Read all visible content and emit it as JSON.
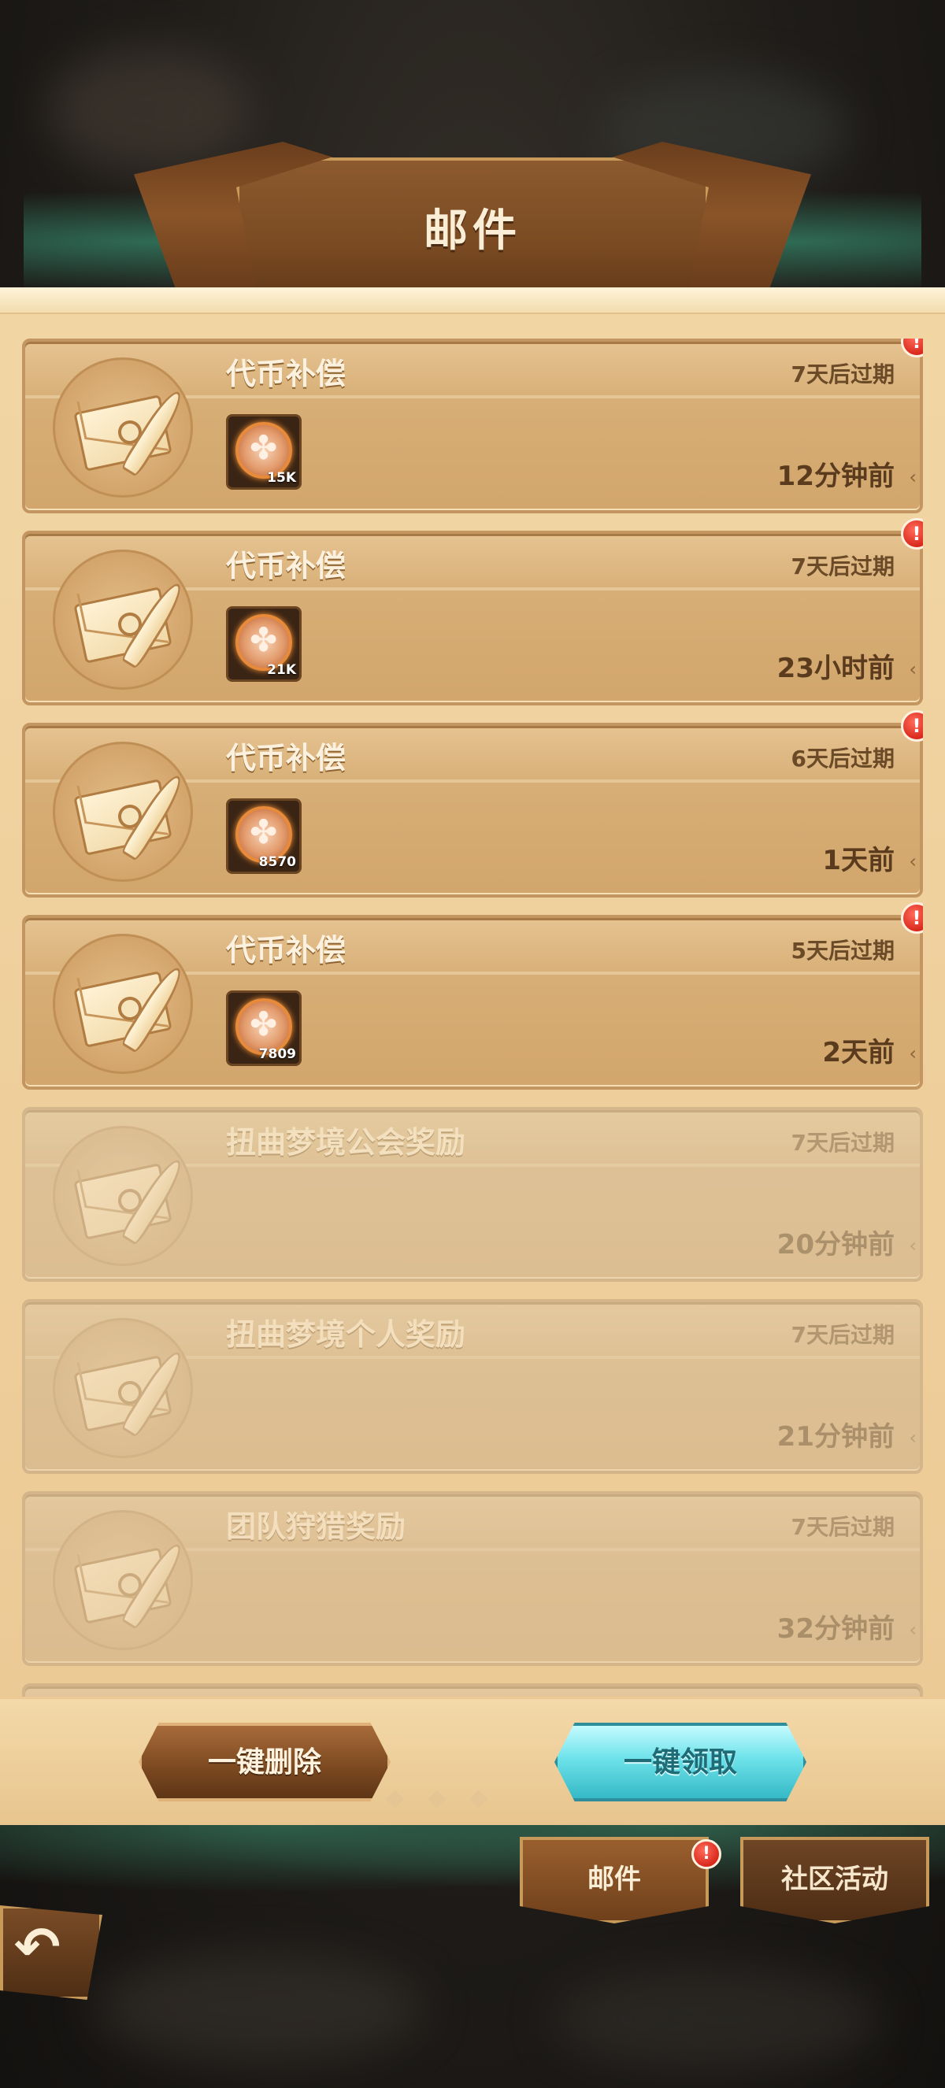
{
  "header": {
    "title": "邮件"
  },
  "mails": [
    {
      "title": "代币补偿",
      "expire": "7天后过期",
      "time": "12分钟前",
      "qty": "15K",
      "unread": true,
      "badge": "!"
    },
    {
      "title": "代币补偿",
      "expire": "7天后过期",
      "time": "23小时前",
      "qty": "21K",
      "unread": true,
      "badge": "!"
    },
    {
      "title": "代币补偿",
      "expire": "6天后过期",
      "time": "1天前",
      "qty": "8570",
      "unread": true,
      "badge": "!"
    },
    {
      "title": "代币补偿",
      "expire": "5天后过期",
      "time": "2天前",
      "qty": "7809",
      "unread": true,
      "badge": "!"
    },
    {
      "title": "扭曲梦境公会奖励",
      "expire": "7天后过期",
      "time": "20分钟前",
      "unread": false
    },
    {
      "title": "扭曲梦境个人奖励",
      "expire": "7天后过期",
      "time": "21分钟前",
      "unread": false
    },
    {
      "title": "团队狩猎奖励",
      "expire": "7天后过期",
      "time": "32分钟前",
      "unread": false
    }
  ],
  "actions": {
    "delete_all": "一键删除",
    "claim_all": "一键领取"
  },
  "tabs": {
    "mail": "邮件",
    "community": "社区活动",
    "mail_badge": "!"
  },
  "icons": {
    "envelope": "envelope-quill-icon",
    "attachment": "token-coin-icon",
    "back": "back-arrow-icon",
    "chevron": "chevron-left-icon"
  },
  "colors": {
    "accent_claim": "#6ee2ea",
    "accent_delete": "#7a4820",
    "badge": "#d9291c"
  }
}
